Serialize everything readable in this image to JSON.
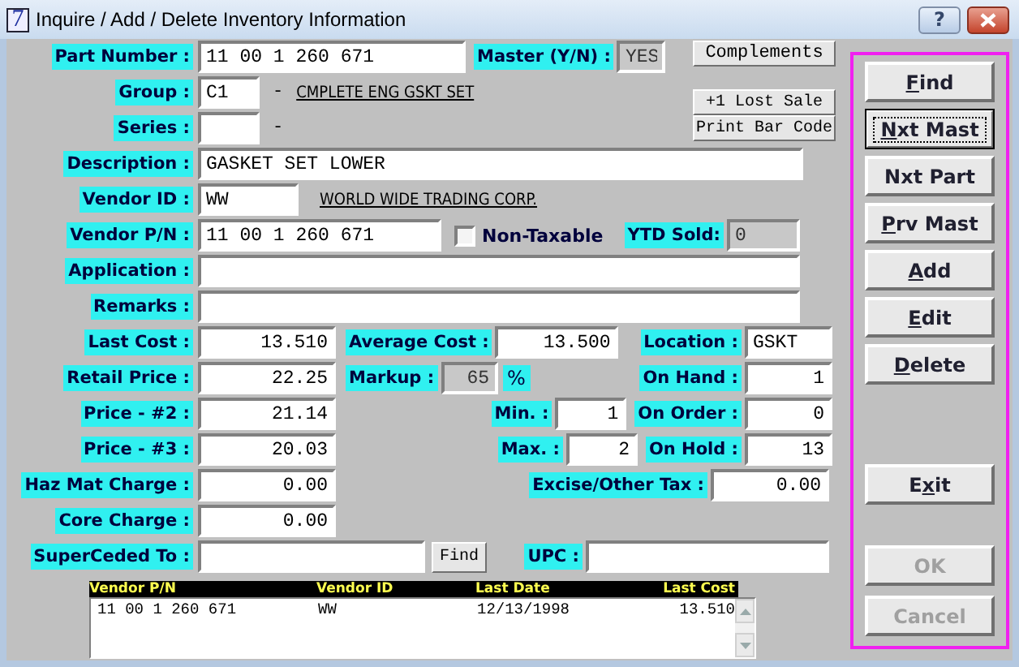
{
  "window": {
    "title": "Inquire / Add / Delete  Inventory Information",
    "icon_text": "7",
    "help_button": "?"
  },
  "form": {
    "part_number": {
      "label": "Part Number :",
      "value": "11 00 1 260 671"
    },
    "master": {
      "label": "Master (Y/N) :",
      "value": "YES",
      "readonly": true
    },
    "group": {
      "label": "Group :",
      "value": "C1"
    },
    "group_dash": "-",
    "group_name": "CMPLETE ENG GSKT SET",
    "series": {
      "label": "Series :"
    },
    "series_dash": "-",
    "description": {
      "label": "Description :",
      "value": "GASKET SET LOWER"
    },
    "vendor_id": {
      "label": "Vendor ID :",
      "value": "WW"
    },
    "vendor_name": "WORLD WIDE TRADING CORP.",
    "vendor_pn": {
      "label": "Vendor P/N :",
      "value": "11 00 1 260 671"
    },
    "non_taxable": {
      "label": "Non-Taxable",
      "checked": false
    },
    "ytd_sold": {
      "label": "YTD Sold:",
      "value": "0",
      "readonly": true
    },
    "application": {
      "label": "Application :"
    },
    "remarks": {
      "label": "Remarks :"
    },
    "last_cost": {
      "label": "Last Cost :",
      "value": "13.510"
    },
    "average_cost": {
      "label": "Average Cost :",
      "value": "13.500"
    },
    "location": {
      "label": "Location :",
      "value": "GSKT"
    },
    "retail_price": {
      "label": "Retail Price :",
      "value": "22.25"
    },
    "markup": {
      "label": "Markup :",
      "value": "65",
      "readonly": true
    },
    "markup_unit": "%",
    "on_hand": {
      "label": "On Hand :",
      "value": "1"
    },
    "price_2": {
      "label": "Price - #2 :",
      "value": "21.14"
    },
    "min": {
      "label": "Min. :",
      "value": "1"
    },
    "on_order": {
      "label": "On Order :",
      "value": "0"
    },
    "price_3": {
      "label": "Price - #3 :",
      "value": "20.03"
    },
    "max": {
      "label": "Max. :",
      "value": "2"
    },
    "on_hold": {
      "label": "On Hold :",
      "value": "13"
    },
    "haz_mat_charge": {
      "label": "Haz Mat Charge :",
      "value": "0.00"
    },
    "excise_tax": {
      "label": "Excise/Other Tax :",
      "value": "0.00"
    },
    "core_charge": {
      "label": "Core Charge :",
      "value": "0.00"
    },
    "superceded_to": {
      "label": "SuperCeded To :"
    },
    "upc": {
      "label": "UPC :"
    }
  },
  "buttons": {
    "complements": "Complements",
    "lost_sale": "+1 Lost Sale",
    "print_bar_code": "Print Bar Code",
    "find_superceded": "Find"
  },
  "vendor_table": {
    "columns": [
      "Vendor P/N",
      "Vendor ID",
      "Last Date",
      "Last Cost"
    ],
    "rows": [
      [
        "11 00 1 260 671",
        "WW",
        "12/13/1998",
        "13.510"
      ]
    ]
  },
  "actions": [
    [
      {
        "key": "F",
        "after": "ind",
        "focused": false,
        "disabled": false
      },
      {
        "key": "N",
        "after": "xt Mast",
        "focused": true,
        "disabled": false
      },
      {
        "before": "Nxt Part",
        "focused": false,
        "disabled": false
      },
      {
        "key": "P",
        "after": "rv Mast",
        "focused": false,
        "disabled": false
      },
      {
        "key": "A",
        "after": "dd",
        "focused": false,
        "disabled": false
      },
      {
        "key": "E",
        "after": "dit",
        "focused": false,
        "disabled": false
      },
      {
        "key": "D",
        "after": "elete",
        "focused": false,
        "disabled": false
      }
    ],
    [
      {
        "before": "E",
        "key": "x",
        "after": "it",
        "focused": false,
        "disabled": false
      }
    ],
    [
      {
        "before": "OK",
        "focused": false,
        "disabled": true
      },
      {
        "before": "Cancel",
        "focused": false,
        "disabled": true
      }
    ]
  ]
}
